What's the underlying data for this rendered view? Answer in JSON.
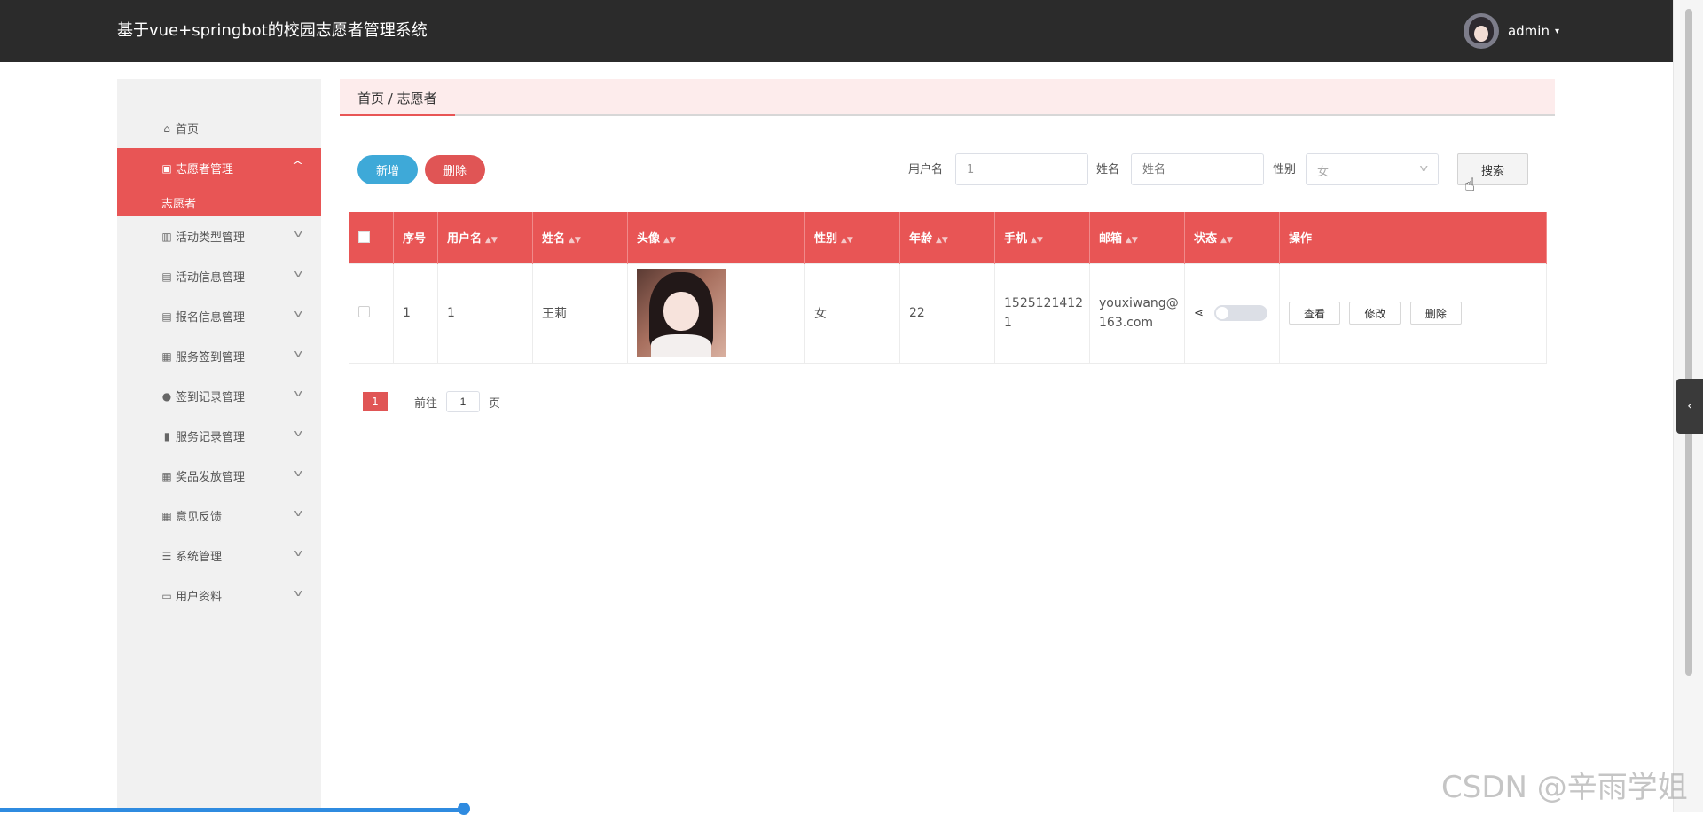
{
  "header": {
    "title": "基于vue+springbot的校园志愿者管理系统",
    "username": "admin",
    "caret": "▾"
  },
  "sidebar": {
    "items": [
      {
        "label": "首页",
        "icon": "home-icon",
        "glyph": "⌂",
        "active": false
      },
      {
        "label": "志愿者管理",
        "icon": "list-icon",
        "glyph": "▣",
        "active": true,
        "chevron": "^",
        "sub": [
          "志愿者"
        ]
      },
      {
        "label": "活动类型管理",
        "icon": "chart-icon",
        "glyph": "▥",
        "chevron": "v"
      },
      {
        "label": "活动信息管理",
        "icon": "clipboard-icon",
        "glyph": "▤",
        "chevron": "v"
      },
      {
        "label": "报名信息管理",
        "icon": "clipboard-icon",
        "glyph": "▤",
        "chevron": "v"
      },
      {
        "label": "服务签到管理",
        "icon": "grid-icon",
        "glyph": "▦",
        "chevron": "v"
      },
      {
        "label": "签到记录管理",
        "icon": "user-icon",
        "glyph": "●",
        "chevron": "v"
      },
      {
        "label": "服务记录管理",
        "icon": "bar-chart-icon",
        "glyph": "▮",
        "chevron": "v"
      },
      {
        "label": "奖品发放管理",
        "icon": "grid-icon",
        "glyph": "▦",
        "chevron": "v"
      },
      {
        "label": "意见反馈",
        "icon": "grid-icon",
        "glyph": "▦",
        "chevron": "v"
      },
      {
        "label": "系统管理",
        "icon": "list-lines-icon",
        "glyph": "☰",
        "chevron": "v"
      },
      {
        "label": "用户资料",
        "icon": "card-icon",
        "glyph": "▭",
        "chevron": "v"
      }
    ]
  },
  "breadcrumb": "首页 / 志愿者",
  "toolbar": {
    "add_label": "新增",
    "delete_label": "删除",
    "username_label": "用户名",
    "username_value": "1",
    "name_label": "姓名",
    "name_placeholder": "姓名",
    "gender_label": "性别",
    "gender_value": "女",
    "search_label": "搜索"
  },
  "table": {
    "headers": [
      "序号",
      "用户名",
      "姓名",
      "头像",
      "性别",
      "年龄",
      "手机",
      "邮箱",
      "状态",
      "操作"
    ],
    "rows": [
      {
        "index": "1",
        "username": "1",
        "name": "王莉",
        "gender": "女",
        "age": "22",
        "phone": "15251214121",
        "email": "youxiwang@163.com",
        "status_on": false,
        "actions": [
          "查看",
          "修改",
          "删除"
        ]
      }
    ]
  },
  "pagination": {
    "current_page": "1",
    "goto_prefix": "前往",
    "goto_value": "1",
    "goto_suffix": "页"
  },
  "watermark": "CSDN @辛雨学姐",
  "colors": {
    "accent": "#e85555",
    "topbar": "#2b2b2b",
    "add_button": "#3ea9d8",
    "sidebar_bg": "#f1f1f1"
  }
}
